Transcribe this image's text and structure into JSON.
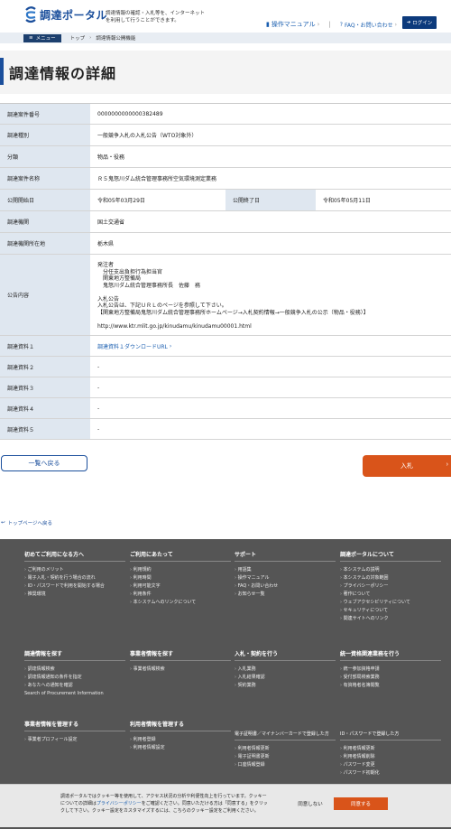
{
  "header": {
    "logo_text": "調達ポータル",
    "tagline": "調達情報の確認・入札等を、インターネットを利用して行うことができます。",
    "manual_label": "操作マニュアル",
    "faq_label": "FAQ・お問い合わせ",
    "login_label": "ログイン"
  },
  "breadcrumb": {
    "menu_label": "メニュー",
    "top": "トップ",
    "current": "調達情報公開機能"
  },
  "page_title": "調達情報の詳細",
  "detail": {
    "rows": [
      {
        "label": "調達案件番号",
        "value": "0000000000000382489"
      },
      {
        "label": "調達種別",
        "value": "一般競争入札の入札公告（WTO対象外）"
      },
      {
        "label": "分類",
        "value": "物品・役務"
      },
      {
        "label": "調達案件名称",
        "value": "Ｒ５鬼怒川ダム統合管理事務所空気環境測定業務"
      }
    ],
    "start_label": "公開開始日",
    "start_value": "令和05年03月29日",
    "end_label": "公開終了日",
    "end_value": "令和05年05月11日",
    "agency_label": "調達機関",
    "agency_value": "国土交通省",
    "location_label": "調達機関所在地",
    "location_value": "栃木県",
    "notice_label": "公告内容",
    "notice_value": "発注者\n　分任支出負担行為担当官\n　関東地方整備局\n　鬼怒川ダム統合管理事務所長　佐藤　務\n\n入札公告\n入札公告は、下記ＵＲＬのページを参照して下さい。\n【関東地方整備局鬼怒川ダム統合管理事務所ホームページ→入札契約情報→一般競争入札の公示（物品・役務）】\n\nhttp://www.ktr.mlit.go.jp/kinudamu/kinudamu00001.html",
    "doc1_label": "調達資料１",
    "doc1_value": "調達資料１ダウンロードURL",
    "doc2_label": "調達資料２",
    "doc2_value": "-",
    "doc3_label": "調達資料３",
    "doc3_value": "-",
    "doc4_label": "調達資料４",
    "doc4_value": "-",
    "doc5_label": "調達資料５",
    "doc5_value": "-"
  },
  "buttons": {
    "back": "一覧へ戻る",
    "bid": "入札",
    "top_page": "トップページへ戻る"
  },
  "footer": {
    "col1_title": "初めてご利用になる方へ",
    "col1_items": [
      "ご利用のメリット",
      "電子入札・契約を行う場合の流れ",
      "ID・パスワードで利用を開始する場合",
      "推奨環境"
    ],
    "col2_title": "ご利用にあたって",
    "col2_items": [
      "利用規約",
      "利用時間",
      "利用可能文字",
      "利用条件",
      "本システムへのリンクについて"
    ],
    "col3_title": "サポート",
    "col3_items": [
      "用語集",
      "操作マニュアル",
      "FAQ・お問い合わせ",
      "お知らせ一覧"
    ],
    "col4_title": "調達ポータルについて",
    "col4_items": [
      "本システムの説明",
      "本システムの対象範囲",
      "プライバシーポリシー",
      "著作について",
      "ウェブアクセシビリティについて",
      "セキュリティについて",
      "関連サイトへのリンク"
    ],
    "col5_title": "調達情報を探す",
    "col5_items": [
      "調達情報検索",
      "調達情報通知の条件を指定",
      "あなたへの通知を確認",
      "Search of Procurement Information"
    ],
    "col6_title": "事業者情報を探す",
    "col6_items": [
      "事業者情報検索"
    ],
    "col7_title": "入札・契約を行う",
    "col7_items": [
      "入札業務",
      "入札結果確認",
      "契約業務"
    ],
    "col8_title": "統一資格関連業務を行う",
    "col8_items": [
      "統一参加資格申請",
      "受付部局検索業務",
      "有資格者名簿閲覧"
    ],
    "col9_title": "事業者情報を管理する",
    "col9_items": [
      "事業者プロフィール設定"
    ],
    "col10_title": "利用者情報を管理する",
    "col10_items": [
      "利用者登録",
      "利用者情報設定"
    ],
    "col11_title": "電子証明書／マイナンバーカードで登録した方",
    "col11_items": [
      "利用者情報更新",
      "電子証明書更新",
      "口座情報登録"
    ],
    "col12_title": "ID・パスワードで登録した方",
    "col12_items": [
      "利用者情報更新",
      "利用者情報削除",
      "パスワード変更",
      "パスワード初期化"
    ]
  },
  "cookie": {
    "text_before": "調達ポータルではクッキー等を使用して、アクセス状況の分析や利便性向上を行っています。クッキーについての詳細は",
    "policy_link": "プライバシーポリシー",
    "text_after": "をご確認ください。同意いただける方は「同意する」をクリックして下さい。クッキー設定をカスタマイズするには、こちらのクッキー設定をご利用ください。",
    "decline": "同意しない",
    "accept": "同意する"
  }
}
